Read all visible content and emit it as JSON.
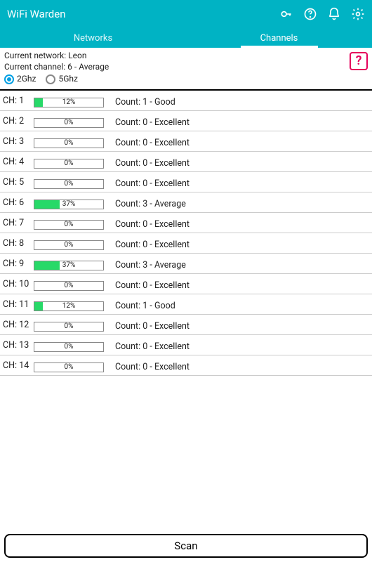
{
  "header": {
    "title": "WiFi Warden"
  },
  "tabs": {
    "networks": "Networks",
    "channels": "Channels",
    "active": "channels"
  },
  "info": {
    "network_label": "Current network: Leon",
    "channel_label": "Current channel: 6 - Average",
    "radio_2ghz": "2Ghz",
    "radio_5ghz": "5Ghz",
    "help": "?"
  },
  "channels": [
    {
      "ch": "CH: 1",
      "pct": 12,
      "pct_label": "12%",
      "count": "Count: 1 - Good"
    },
    {
      "ch": "CH: 2",
      "pct": 0,
      "pct_label": "0%",
      "count": "Count: 0 - Excellent"
    },
    {
      "ch": "CH: 3",
      "pct": 0,
      "pct_label": "0%",
      "count": "Count: 0 - Excellent"
    },
    {
      "ch": "CH: 4",
      "pct": 0,
      "pct_label": "0%",
      "count": "Count: 0 - Excellent"
    },
    {
      "ch": "CH: 5",
      "pct": 0,
      "pct_label": "0%",
      "count": "Count: 0 - Excellent"
    },
    {
      "ch": "CH: 6",
      "pct": 37,
      "pct_label": "37%",
      "count": "Count: 3 - Average"
    },
    {
      "ch": "CH: 7",
      "pct": 0,
      "pct_label": "0%",
      "count": "Count: 0 - Excellent"
    },
    {
      "ch": "CH: 8",
      "pct": 0,
      "pct_label": "0%",
      "count": "Count: 0 - Excellent"
    },
    {
      "ch": "CH: 9",
      "pct": 37,
      "pct_label": "37%",
      "count": "Count: 3 - Average"
    },
    {
      "ch": "CH: 10",
      "pct": 0,
      "pct_label": "0%",
      "count": "Count: 0 - Excellent"
    },
    {
      "ch": "CH: 11",
      "pct": 12,
      "pct_label": "12%",
      "count": "Count: 1 - Good"
    },
    {
      "ch": "CH: 12",
      "pct": 0,
      "pct_label": "0%",
      "count": "Count: 0 - Excellent"
    },
    {
      "ch": "CH: 13",
      "pct": 0,
      "pct_label": "0%",
      "count": "Count: 0 - Excellent"
    },
    {
      "ch": "CH: 14",
      "pct": 0,
      "pct_label": "0%",
      "count": "Count: 0 - Excellent"
    }
  ],
  "footer": {
    "scan": "Scan"
  }
}
